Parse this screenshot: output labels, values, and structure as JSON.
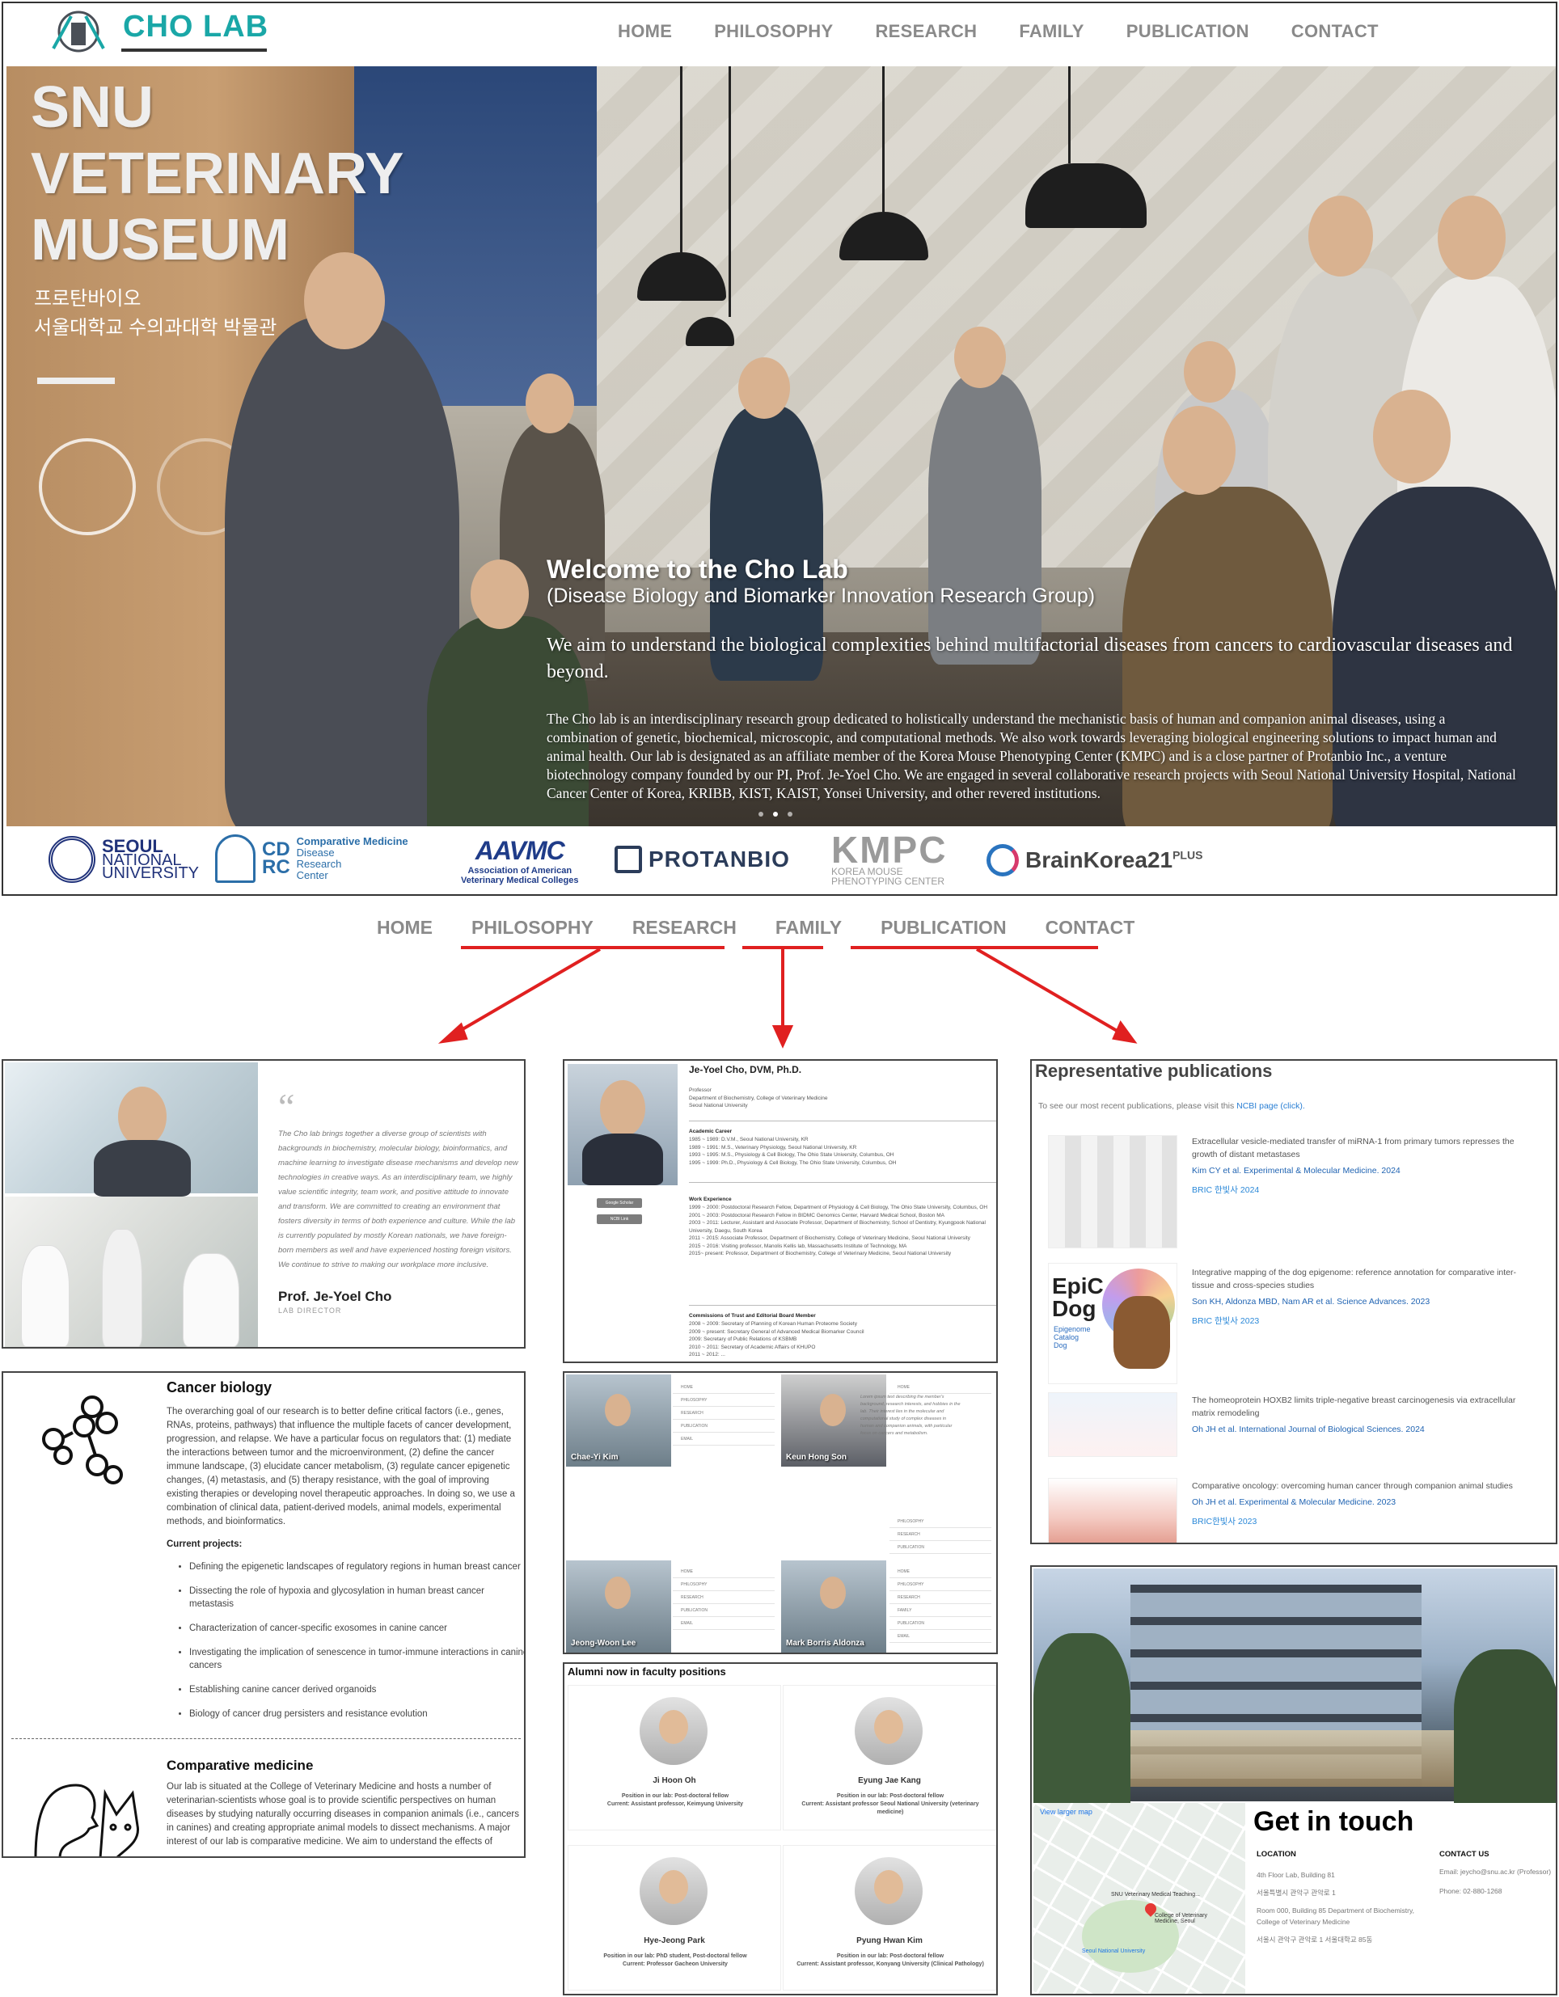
{
  "site": {
    "logo_text": "CHO LAB",
    "nav": [
      "HOME",
      "PHILOSOPHY",
      "RESEARCH",
      "FAMILY",
      "PUBLICATION",
      "CONTACT"
    ]
  },
  "hero": {
    "museum_title": [
      "SNU",
      "VETERINARY",
      "MUSEUM"
    ],
    "museum_kr": [
      "프로탄바이오",
      "서울대학교 수의과대학 박물관"
    ],
    "welcome": "Welcome to the Cho Lab",
    "subtitle": "(Disease Biology and Biomarker Innovation Research Group)",
    "aim": "We aim to understand the biological complexities behind multifactorial diseases from cancers to cardiovascular diseases and beyond.",
    "about": "The Cho lab is an interdisciplinary research group dedicated to holistically understand the mechanistic basis of human and companion animal diseases, using a combination of genetic, biochemical, microscopic, and computational methods. We also work towards leveraging biological engineering solutions to impact human and animal health. Our lab is designated as an affiliate member of the Korea Mouse Phenotyping Center (KMPC) and is a close partner of Protanbio Inc., a venture biotechnology company founded by our PI, Prof. Je-Yoel Cho. We are engaged in several collaborative research projects with Seoul National University Hospital, National Cancer Center of Korea, KRIBB, KIST, KAIST, Yonsei University, and other revered institutions."
  },
  "partners": {
    "snu": [
      "SEOUL",
      "NATIONAL",
      "UNIVERSITY"
    ],
    "cdrc": {
      "box": [
        "CD",
        "RC"
      ],
      "text": [
        "Comparative Medicine",
        "Disease",
        "Research",
        "Center"
      ]
    },
    "aavmc": {
      "abbr": "AAVMC",
      "text": [
        "Association of American",
        "Veterinary Medical Colleges"
      ]
    },
    "protanbio": "PROTANBIO",
    "kmpc": {
      "abbr": "KMPC",
      "text": [
        "KOREA MOUSE",
        "PHENOTYPING CENTER"
      ]
    },
    "bk": {
      "name": "BrainKorea21",
      "sup": "PLUS"
    }
  },
  "nav2": [
    "HOME",
    "PHILOSOPHY",
    "RESEARCH",
    "FAMILY",
    "PUBLICATION",
    "CONTACT"
  ],
  "colors": {
    "accent": "#1aa7a7",
    "arrow": "#e02020",
    "link": "#1f63b2"
  },
  "philosophy": {
    "quote_mark": "“",
    "text": "The Cho lab brings together a diverse group of scientists with backgrounds in biochemistry, molecular biology, bioinformatics, and machine learning to investigate disease mechanisms and develop new technologies in creative ways. As an interdisciplinary team, we highly value scientific integrity, team work, and positive attitude to innovate and transform. We are committed to creating an environment that fosters diversity in terms of both experience and culture. While the lab is currently populated by mostly Korean nationals, we have foreign-born members as well and have experienced hosting foreign visitors. We continue to strive to making our workplace more inclusive.",
    "name": "Prof. Je-Yoel Cho",
    "role": "LAB DIRECTOR"
  },
  "research": {
    "title": "Cancer biology",
    "text": "The overarching goal of our research is to better define critical factors (i.e., genes, RNAs, proteins, pathways) that influence the multiple facets of cancer development, progression, and relapse. We have a particular focus on regulators that: (1) mediate the interactions between tumor and the microenvironment, (2) define the cancer immune landscape, (3) elucidate cancer metabolism, (3) regulate cancer epigenetic changes, (4) metastasis, and (5) therapy resistance, with the goal of improving existing therapies or developing novel therapeutic approaches. In doing so, we use a combination of clinical data, patient-derived models, animal models, experimental methods, and bioinformatics.",
    "current_label": "Current projects:",
    "projects": [
      "Defining the epigenetic landscapes of regulatory regions in human breast cancer",
      "Dissecting the role of hypoxia and glycosylation in human breast cancer metastasis",
      "Characterization of cancer-specific exosomes in canine cancer",
      "Investigating the implication of senescence in tumor-immune interactions in canine cancers",
      "Establishing canine cancer derived organoids",
      "Biology of cancer drug persisters and resistance evolution"
    ],
    "title2": "Comparative medicine",
    "text2": "Our lab is situated at the College of Veterinary Medicine and hosts a number of veterinarian-scientists whose goal is to provide scientific perspectives on human diseases by studying naturally occurring diseases in companion animals (i.e., cancers in canines) and creating appropriate animal models to dissect mechanisms. A major interest of our lab is comparative medicine. We aim to understand the effects of"
  },
  "profile": {
    "name": "Je-Yoel Cho, DVM, Ph.D.",
    "position": [
      "Professor",
      "Department of Biochemistry, College of Veterinary Medicine",
      "Seoul National University"
    ],
    "buttons": [
      "Google Scholar",
      "NCBI Link"
    ],
    "career_label": "Academic Career",
    "career": [
      "1985 ~ 1989: D.V.M., Seoul National University, KR",
      "1989 ~ 1991: M.S., Veterinary Physiology, Seoul National University, KR",
      "1993 ~ 1995: M.S., Physiology & Cell Biology, The Ohio State University, Columbus, OH",
      "1995 ~ 1999: Ph.D., Physiology & Cell Biology, The Ohio State University, Columbus, OH"
    ],
    "work_label": "Work Experience",
    "work": [
      "1999 ~ 2000: Postdoctoral Research Fellow, Department of Physiology & Cell Biology, The Ohio State University, Columbus, OH",
      "2001 ~ 2003: Postdoctoral Research Fellow in BIDMC Genomics Center, Harvard Medical School, Boston MA",
      "2003 ~ 2011: Lecturer, Assistant and Associate Professor, Department of Biochemistry, School of Dentistry, Kyungpook National University, Daegu, South Korea",
      "2011 ~ 2015: Associate Professor, Department of Biochemistry, College of Veterinary Medicine, Seoul National University",
      "2015 ~ 2016: Visiting professor, Manolis Kellis lab, Massachusetts Institute of Technology, MA",
      "2015~ present: Professor, Department of Biochemistry, College of Veterinary Medicine, Seoul National University"
    ],
    "comm_label": "Commissions of Trust and Editorial Board Member",
    "comm": [
      "2008 ~ 2009: Secretary of Planning of Korean Human Proteome Society",
      "2009 ~ present: Secretary General of Advanced Medical Biomarker Council",
      "2009: Secretary of Public Relations of KSBMB",
      "2010 ~ 2011: Secretary of Academic Affairs of KHUPO",
      "2011 ~ 2012: ..."
    ]
  },
  "members": {
    "cards": [
      "Chae-Yi Kim",
      "Keun Hong Son",
      "Jeong-Woon Lee",
      "Mark Borris Aldonza"
    ],
    "menu": [
      "HOME",
      "PHILOSOPHY",
      "RESEARCH",
      "FAMILY",
      "PUBLICATION",
      "EMAIL"
    ],
    "body": "Lorem ipsum text describing the member's background, research interests, and hobbies in the lab. Their interest lies in the molecular and computational study of complex diseases in human and companion animals, with particular focus on cancers and metabolism."
  },
  "alumni": {
    "title": "Alumni now in faculty positions",
    "people": [
      {
        "name": "Ji Hoon Oh",
        "lab": "Position in our lab: Post-doctoral fellow",
        "current": "Current: Assistant professor, Keimyung University"
      },
      {
        "name": "Eyung Jae Kang",
        "lab": "Position in our lab: Post-doctoral fellow",
        "current": "Current: Assistant professor Seoul National University (veterinary medicine)"
      },
      {
        "name": "Hye-Jeong Park",
        "lab": "Position in our lab: PhD student, Post-doctoral fellow",
        "current": "Current: Professor Gacheon University"
      },
      {
        "name": "Pyung Hwan Kim",
        "lab": "Position in our lab: Post-doctoral fellow",
        "current": "Current: Assistant professor, Konyang University (Clinical Pathology)"
      }
    ]
  },
  "publications": {
    "title": "Representative publications",
    "intro": "To see our most recent publications, please visit this ",
    "intro_link": "NCBI page (click).",
    "items": [
      {
        "title": "Extracellular vesicle-mediated transfer of miRNA-1 from primary tumors represses the growth of distant metastases",
        "authors": "Kim CY et al. Experimental & Molecular Medicine. 2024",
        "brief": "BRIC 한빛사 2024"
      },
      {
        "title": "Integrative mapping of the dog epigenome: reference annotation for comparative inter-tissue and cross-species studies",
        "authors": "Son KH, Aldonza MBD, Nam AR et al. Science Advances. 2023",
        "brief": "BRIC 한빛사 2023"
      },
      {
        "title": "The homeoprotein HOXB2 limits triple-negative breast carcinogenesis via extracellular matrix remodeling",
        "authors": "Oh JH et al. International Journal of Biological Sciences. 2024",
        "brief": ""
      },
      {
        "title": "Comparative oncology: overcoming human cancer through companion animal studies",
        "authors": "Oh JH et al. Experimental & Molecular Medicine. 2023",
        "brief": "BRIC한빛사 2023"
      }
    ],
    "epic": [
      "EpiC",
      "Dog"
    ],
    "epic_sub": [
      "Epigenome",
      "Catalog",
      "Dog"
    ]
  },
  "contact": {
    "title": "Get in touch",
    "map_link": "View larger map",
    "map_labels": [
      "SNU Veterinary Medical Teaching...",
      "College of Veterinary Medicine, Seoul",
      "Seoul National University"
    ],
    "loc_label": "LOCATION",
    "loc": [
      "4th Floor Lab, Building 81",
      "서울특별시 관악구 관악로 1",
      "Room 000, Building 85 Department of Biochemistry, College of Veterinary Medicine",
      "서울시 관악구 관악로 1 서울대학교 85동"
    ],
    "contact_label": "CONTACT US",
    "contact": [
      "Email: jeycho@snu.ac.kr (Professor)",
      "Phone: 02-880-1268"
    ]
  }
}
